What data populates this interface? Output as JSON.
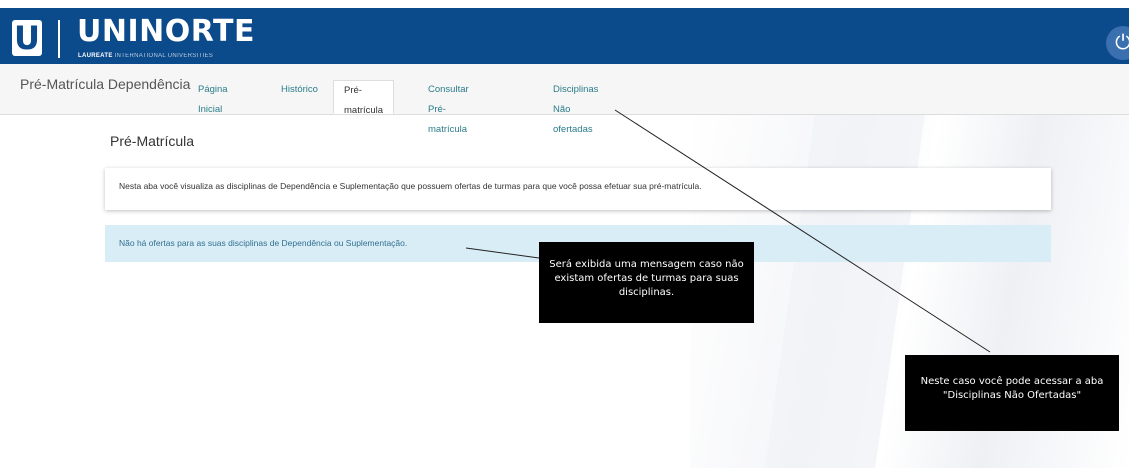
{
  "header": {
    "logo_letter": "U",
    "brand_name": "UNINORTE",
    "brand_sub_bold": "LAUREATE",
    "brand_sub_rest": "INTERNATIONAL UNIVERSITIES",
    "power_icon": "power-icon",
    "brand_color": "#0b4a8b"
  },
  "nav": {
    "page_heading": "Pré-Matrícula Dependência",
    "tabs": [
      {
        "label": "Página Inicial"
      },
      {
        "label": "Histórico"
      },
      {
        "label": "Pré-matrícula"
      },
      {
        "label": "Consultar Pré-matrícula"
      },
      {
        "label": "Disciplinas Não ofertadas"
      }
    ],
    "active_tab": "Pré-matrícula"
  },
  "main": {
    "title": "Pré-Matrícula",
    "info_text": "Nesta aba você visualiza as disciplinas de Dependência e Suplementação que possuem ofertas de turmas para que você possa efetuar sua pré-matrícula.",
    "alert_text": "Não há ofertas para as suas disciplinas de Dependência ou Suplementação."
  },
  "annotations": {
    "callout_1": "Será exibida uma mensagem caso não existam ofertas de turmas para suas disciplinas.",
    "callout_2": "Neste caso você pode acessar a aba \"Disciplinas Não Ofertadas\""
  }
}
